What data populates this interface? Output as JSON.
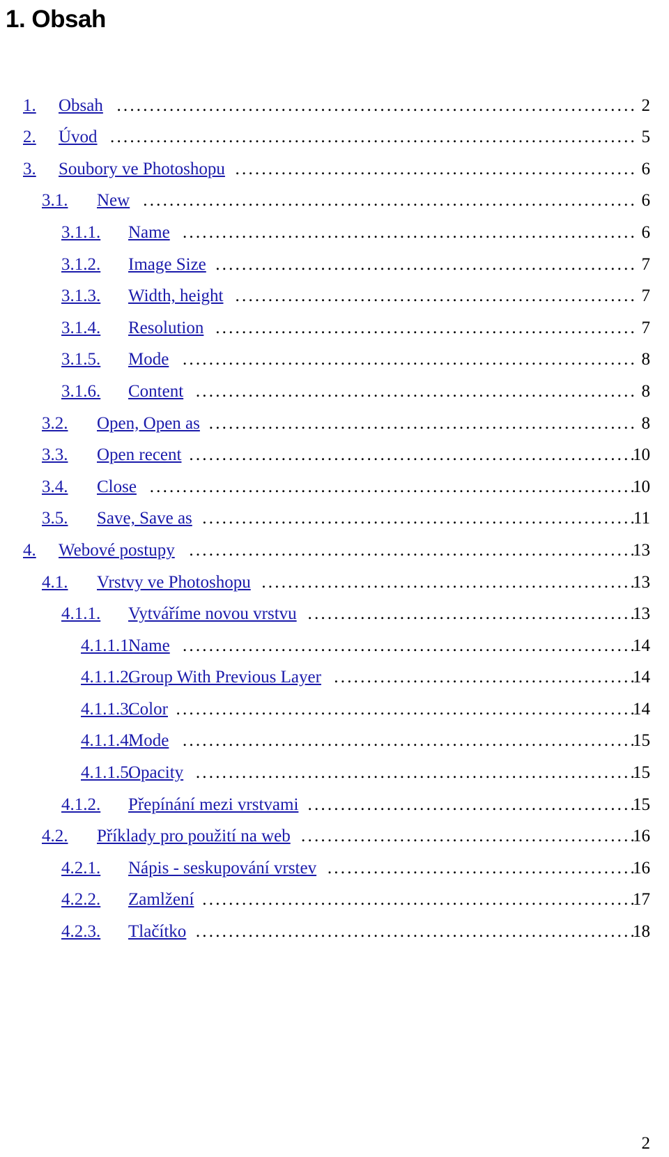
{
  "document": {
    "heading": "1. Obsah",
    "link_color": "#1b1bab",
    "text_color": "#000000",
    "background_color": "#ffffff",
    "footer_page_number": "2"
  },
  "toc": {
    "entries": [
      {
        "number": "1.",
        "label": "Obsah",
        "page": "2",
        "level": 1
      },
      {
        "number": "2.",
        "label": "Úvod",
        "page": "5",
        "level": 1
      },
      {
        "number": "3.",
        "label": "Soubory ve Photoshopu",
        "page": "6",
        "level": 1
      },
      {
        "number": "3.1.",
        "label": "New",
        "page": "6",
        "level": 2
      },
      {
        "number": "3.1.1.",
        "label": "Name",
        "page": "6",
        "level": 3
      },
      {
        "number": "3.1.2.",
        "label": "Image Size",
        "page": "7",
        "level": 3
      },
      {
        "number": "3.1.3.",
        "label": "Width, height",
        "page": "7",
        "level": 3
      },
      {
        "number": "3.1.4.",
        "label": "Resolution",
        "page": "7",
        "level": 3
      },
      {
        "number": "3.1.5.",
        "label": "Mode",
        "page": "8",
        "level": 3
      },
      {
        "number": "3.1.6.",
        "label": "Content",
        "page": "8",
        "level": 3
      },
      {
        "number": "3.2.",
        "label": "Open, Open as",
        "page": "8",
        "level": 2
      },
      {
        "number": "3.3.",
        "label": "Open recent",
        "page": "10",
        "level": 2
      },
      {
        "number": "3.4.",
        "label": "Close",
        "page": "10",
        "level": 2
      },
      {
        "number": "3.5.",
        "label": "Save, Save as",
        "page": "11",
        "level": 2
      },
      {
        "number": "4.",
        "label": "Webové postupy",
        "page": "13",
        "level": 1
      },
      {
        "number": "4.1.",
        "label": "Vrstvy ve Photoshopu",
        "page": "13",
        "level": 2
      },
      {
        "number": "4.1.1.",
        "label": "Vytváříme novou vrstvu",
        "page": "13",
        "level": 3
      },
      {
        "number": "4.1.1.1.",
        "label": "Name",
        "page": "14",
        "level": 4
      },
      {
        "number": "4.1.1.2.",
        "label": "Group With Previous Layer",
        "page": "14",
        "level": 4
      },
      {
        "number": "4.1.1.3.",
        "label": "Color",
        "page": "14",
        "level": 4
      },
      {
        "number": "4.1.1.4.",
        "label": "Mode",
        "page": "15",
        "level": 4
      },
      {
        "number": "4.1.1.5.",
        "label": "Opacity",
        "page": "15",
        "level": 4
      },
      {
        "number": "4.1.2.",
        "label": "Přepínání mezi vrstvami",
        "page": "15",
        "level": 3
      },
      {
        "number": "4.2.",
        "label": "Příklady pro použití na web",
        "page": "16",
        "level": 2
      },
      {
        "number": "4.2.1.",
        "label": "Nápis - seskupování vrstev",
        "page": "16",
        "level": 3
      },
      {
        "number": "4.2.2.",
        "label": "Zamlžení",
        "page": "17",
        "level": 3
      },
      {
        "number": "4.2.3.",
        "label": "Tlačítko",
        "page": "18",
        "level": 3
      }
    ]
  }
}
